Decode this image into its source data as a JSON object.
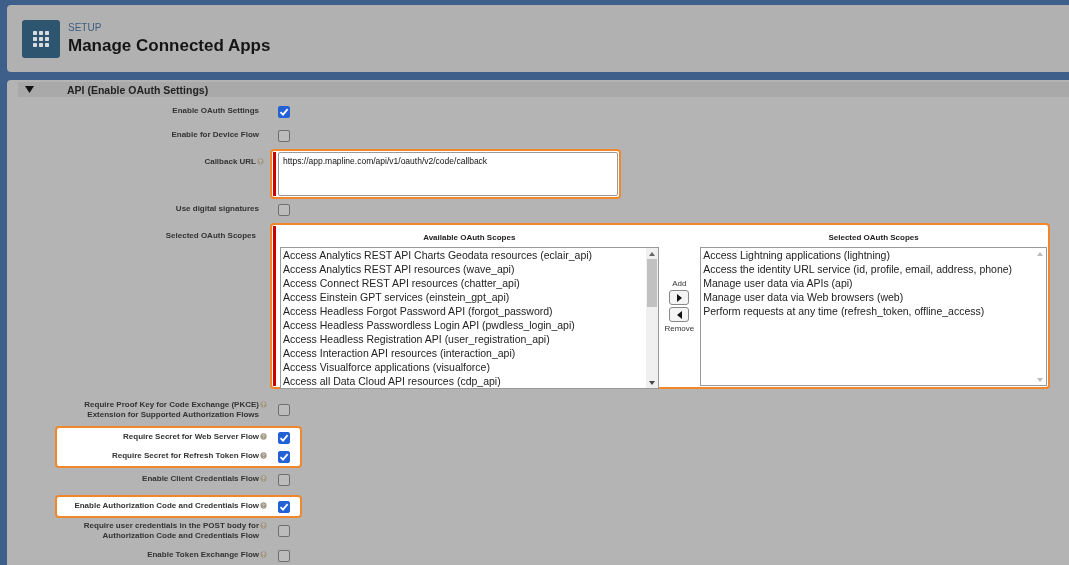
{
  "header": {
    "eyebrow": "SETUP",
    "title": "Manage Connected Apps"
  },
  "section": {
    "title": "API (Enable OAuth Settings)",
    "expanded": true
  },
  "fields": [
    {
      "kind": "checkbox",
      "label": "Enable OAuth Settings",
      "help": false,
      "checked": true,
      "highlighted": false
    },
    {
      "kind": "checkbox",
      "label": "Enable for Device Flow",
      "help": false,
      "checked": false,
      "highlighted": false
    },
    {
      "kind": "textarea",
      "label": "Callback URL",
      "help": true,
      "required": true,
      "highlighted": true,
      "value": "https://app.mapline.com/api/v1/oauth/v2/code/callback"
    },
    {
      "kind": "checkbox",
      "label": "Use digital signatures",
      "help": false,
      "checked": false,
      "highlighted": false
    },
    {
      "kind": "scopes",
      "label": "Selected OAuth Scopes",
      "help": false,
      "required": true,
      "highlighted": true,
      "available_title": "Available OAuth Scopes",
      "selected_title": "Selected OAuth Scopes",
      "add_label": "Add",
      "remove_label": "Remove",
      "available": [
        "Access Analytics REST API Charts Geodata resources (eclair_api)",
        "Access Analytics REST API resources (wave_api)",
        "Access Connect REST API resources (chatter_api)",
        "Access Einstein GPT services (einstein_gpt_api)",
        "Access Headless Forgot Password API (forgot_password)",
        "Access Headless Passwordless Login API (pwdless_login_api)",
        "Access Headless Registration API (user_registration_api)",
        "Access Interaction API resources (interaction_api)",
        "Access Visualforce applications (visualforce)",
        "Access all Data Cloud API resources (cdp_api)"
      ],
      "selected": [
        "Access Lightning applications (lightning)",
        "Access the identity URL service (id, profile, email, address, phone)",
        "Manage user data via APIs (api)",
        "Manage user data via Web browsers (web)",
        "Perform requests at any time (refresh_token, offline_access)"
      ]
    },
    {
      "kind": "checkbox",
      "label": "Require Proof Key for Code Exchange (PKCE)\nExtension for Supported Authorization Flows",
      "help": true,
      "checked": false,
      "highlighted": false
    },
    {
      "kind": "checkbox",
      "label": "Require Secret for Web Server Flow",
      "help": true,
      "checked": true,
      "highlighted": true
    },
    {
      "kind": "checkbox",
      "label": "Require Secret for Refresh Token Flow",
      "help": true,
      "checked": true,
      "highlighted": true
    },
    {
      "kind": "checkbox",
      "label": "Enable Client Credentials Flow",
      "help": true,
      "checked": false,
      "highlighted": false
    },
    {
      "kind": "checkbox",
      "label": "Enable Authorization Code and Credentials Flow",
      "help": true,
      "checked": true,
      "highlighted": true
    },
    {
      "kind": "checkbox",
      "label": "Require user credentials in the POST body for\nAuthorization Code and Credentials Flow",
      "help": true,
      "checked": false,
      "highlighted": false
    },
    {
      "kind": "checkbox",
      "label": "Enable Token Exchange Flow",
      "help": true,
      "checked": false,
      "highlighted": false
    }
  ]
}
